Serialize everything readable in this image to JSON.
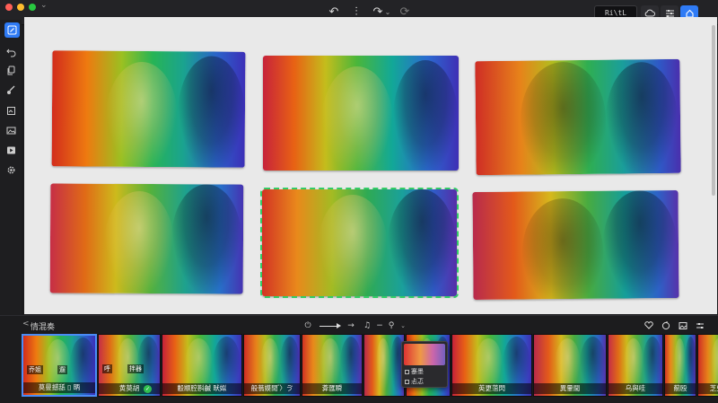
{
  "window": {
    "resolution_badge": "Ri\\tL Di<)",
    "chevron_label": "⌄"
  },
  "toolbar": {
    "undo_label": "↶",
    "split_label": "⫶",
    "redo_label": "↷",
    "refresh_label": "⟳"
  },
  "photos": [
    {
      "gradient": "g1"
    },
    {
      "gradient": "g2"
    },
    {
      "gradient": "g3"
    },
    {
      "gradient": "g4"
    },
    {
      "gradient": "g5",
      "selected": true
    },
    {
      "gradient": "g6"
    }
  ],
  "panel": {
    "title": "情混奏",
    "chevron": "<"
  },
  "playback": {
    "power_label": "⏻",
    "forward_label": "→",
    "music_label": "♫",
    "mode_label": "−",
    "filter_label": "⚲"
  },
  "thumbnails": [
    {
      "label": "莫曼撼舐",
      "tag_left": "乔姐",
      "tag_right": "遛",
      "extra": "▯ 昞",
      "gradient": "g1",
      "active": true
    },
    {
      "label": "黄莫胡",
      "tag_left": "呼",
      "tag_right": "拌器",
      "extra": "",
      "gradient": "g4",
      "ok": true
    },
    {
      "label": "鷇颛腔斟鹹 畎姒",
      "tag_left": "",
      "tag_right": "",
      "extra": "",
      "gradient": "g2"
    },
    {
      "label": "般蓊嫫閒",
      "tag_left": "",
      "tag_right": "",
      "extra": "゙〉ゔ",
      "gradient": "g3"
    },
    {
      "label": "葊匯瞬",
      "tag_left": "",
      "tag_right": "",
      "extra": "",
      "gradient": "g5"
    },
    {
      "label": "",
      "tag_left": "",
      "tag_right": "",
      "extra": "",
      "gradient": "g6"
    },
    {
      "label": "",
      "tag_left": "",
      "tag_right": "",
      "extra": "",
      "gradient": "g1"
    },
    {
      "label": "英更菹閃",
      "tag_left": "",
      "tag_right": "",
      "extra": "",
      "gradient": "g2"
    },
    {
      "label": "異暈閫",
      "tag_left": "",
      "tag_right": "",
      "extra": "",
      "gradient": "g6"
    },
    {
      "label": "乌與哇",
      "tag_left": "",
      "tag_right": "",
      "extra": "",
      "gradient": "g4"
    },
    {
      "label": "葪殴",
      "tag_left": "",
      "tag_right": "",
      "extra": "",
      "gradient": "g5"
    },
    {
      "label": "芝臾暈",
      "tag_left": "",
      "tag_right": "",
      "extra": "",
      "gradient": "g3"
    }
  ],
  "popup": {
    "item1": "蹇墨",
    "item2": "忐忑"
  }
}
